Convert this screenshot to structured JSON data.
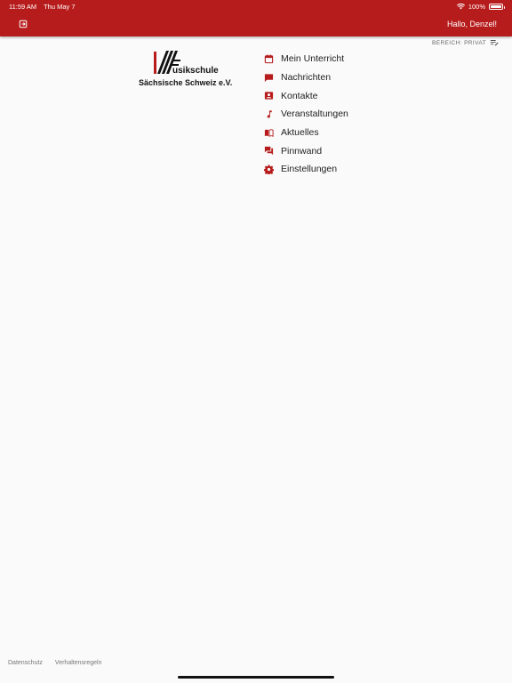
{
  "status": {
    "time": "11:59 AM",
    "date": "Thu May 7",
    "battery": "100%"
  },
  "header": {
    "greeting": "Hallo, Denzel!",
    "logout_icon": "logout-icon"
  },
  "bereich": {
    "label": "BEREICH: PRIVAT",
    "icon": "list-edit-icon"
  },
  "logo": {
    "line1": "usikschule",
    "line2": "Sächsische Schweiz e.V."
  },
  "menu": {
    "items": [
      {
        "label": "Mein Unterricht",
        "icon": "calendar-icon"
      },
      {
        "label": "Nachrichten",
        "icon": "message-icon"
      },
      {
        "label": "Kontakte",
        "icon": "contact-card-icon"
      },
      {
        "label": "Veranstaltungen",
        "icon": "music-note-icon"
      },
      {
        "label": "Aktuelles",
        "icon": "book-open-icon"
      },
      {
        "label": "Pinnwand",
        "icon": "forum-icon"
      },
      {
        "label": "Einstellungen",
        "icon": "gear-icon"
      }
    ]
  },
  "footer": {
    "privacy": "Datenschutz",
    "rules": "Verhaltensregeln"
  },
  "colors": {
    "brand": "#b71c1c",
    "text": "#222222",
    "background": "#fafafa"
  }
}
